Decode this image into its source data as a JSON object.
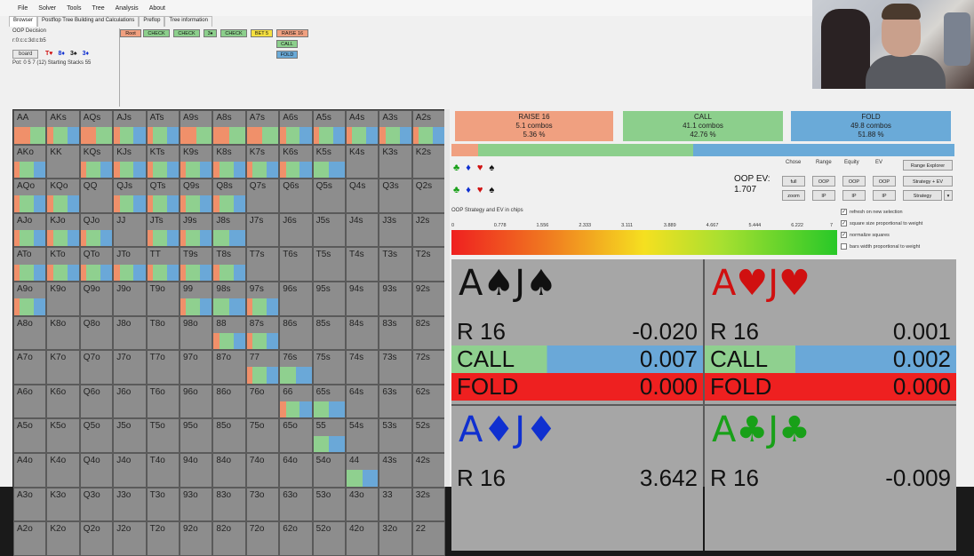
{
  "menu": [
    "File",
    "Solver",
    "Tools",
    "Tree",
    "Analysis",
    "About"
  ],
  "tabs": [
    "Browser",
    "Postflop Tree Building and Calculations",
    "Preflop",
    "Tree information"
  ],
  "info": {
    "decision": "OOP Decision",
    "line": "r:0:c:c:3d:c:b5",
    "board_button": "board",
    "board_cards": [
      {
        "text": "T♥",
        "color": "#d01010"
      },
      {
        "text": "8♦",
        "color": "#1030d0"
      },
      {
        "text": "3♠",
        "color": "#111111"
      },
      {
        "text": "3♦",
        "color": "#1030d0"
      }
    ],
    "pot": "Pot: 0 5 7 (12) Starting Stacks 55"
  },
  "tree": [
    {
      "label": "Root",
      "color": "#f0a080"
    },
    {
      "label": "CHECK",
      "color": "#8ccf8c"
    },
    {
      "label": "CHECK",
      "color": "#8ccf8c"
    },
    {
      "label": "3♦",
      "color": "#8ccf8c"
    },
    {
      "label": "CHECK",
      "color": "#8ccf8c"
    },
    {
      "label": "BET 5",
      "color": "#f5e040"
    },
    {
      "label": "RAISE 16",
      "color": "#f0a080"
    },
    {
      "label": "CALL",
      "color": "#8ccf8c"
    },
    {
      "label": "FOLD",
      "color": "#6aaad8"
    }
  ],
  "grid": {
    "ranks": [
      "A",
      "K",
      "Q",
      "J",
      "T",
      "9",
      "8",
      "7",
      "6",
      "5",
      "4",
      "3",
      "2"
    ],
    "colors": {
      "raise": "#f0906a",
      "call": "#8fd08f",
      "fold": "#6aa8d8",
      "empty": "#8d8d8d"
    }
  },
  "actions": [
    {
      "name": "RAISE 16",
      "combos": "5.1 combos",
      "pct": "5.36 %",
      "color": "#f0a080",
      "freq": 0.0536
    },
    {
      "name": "CALL",
      "combos": "41.1 combos",
      "pct": "42.76 %",
      "color": "#8ccf8c",
      "freq": 0.4276
    },
    {
      "name": "FOLD",
      "combos": "49.8 combos",
      "pct": "51.88 %",
      "color": "#6aaad8",
      "freq": 0.5188
    }
  ],
  "suits_row1": [
    {
      "g": "♣",
      "c": "#18a018"
    },
    {
      "g": "♦",
      "c": "#1030d0"
    },
    {
      "g": "♥",
      "c": "#d01010"
    },
    {
      "g": "♠",
      "c": "#111111"
    }
  ],
  "suits_row2": [
    {
      "g": "♣",
      "c": "#18a018"
    },
    {
      "g": "♦",
      "c": "#1030d0"
    },
    {
      "g": "♥",
      "c": "#d01010"
    },
    {
      "g": "♠",
      "c": "#111111"
    }
  ],
  "oop_ev_label": "OOP EV:",
  "oop_ev_value": "1.707",
  "controls": {
    "heads": [
      "Chose",
      "Range",
      "Equity",
      "EV"
    ],
    "range_explorer": "Range Explorer",
    "row1": [
      "full",
      "OOP",
      "OOP",
      "OOP"
    ],
    "row1_right": "Strategy + EV",
    "row2": [
      "zoom",
      "IP",
      "IP",
      "IP"
    ],
    "row2_right": "Strategy"
  },
  "gradient": {
    "title": "OOP Strategy and EV in chips",
    "ticks": [
      "0",
      "0.778",
      "1.556",
      "2.333",
      "3.111",
      "3.889",
      "4.667",
      "5.444",
      "6.222",
      "7"
    ]
  },
  "checkboxes": [
    {
      "label": "refresh on new selection",
      "checked": true
    },
    {
      "label": "square size proportional to weight",
      "checked": true
    },
    {
      "label": "normalize squares",
      "checked": true
    },
    {
      "label": "bars width proportional to weight",
      "checked": false
    }
  ],
  "hands": [
    {
      "title": "A♠J♠",
      "color": "#111111",
      "r_label": "R 16",
      "r_val": "-0.020",
      "call_label": "CALL",
      "call_val": "0.007",
      "call_frac": 0.38,
      "fold_label": "FOLD",
      "fold_val": "0.000"
    },
    {
      "title": "A♥J♥",
      "color": "#d01010",
      "r_label": "R 16",
      "r_val": "0.001",
      "call_label": "CALL",
      "call_val": "0.002",
      "call_frac": 0.36,
      "fold_label": "FOLD",
      "fold_val": "0.000"
    },
    {
      "title": "A♦J♦",
      "color": "#1030d0",
      "r_label": "R 16",
      "r_val": "3.642"
    },
    {
      "title": "A♣J♣",
      "color": "#18a018",
      "r_label": "R 16",
      "r_val": "-0.009"
    }
  ]
}
